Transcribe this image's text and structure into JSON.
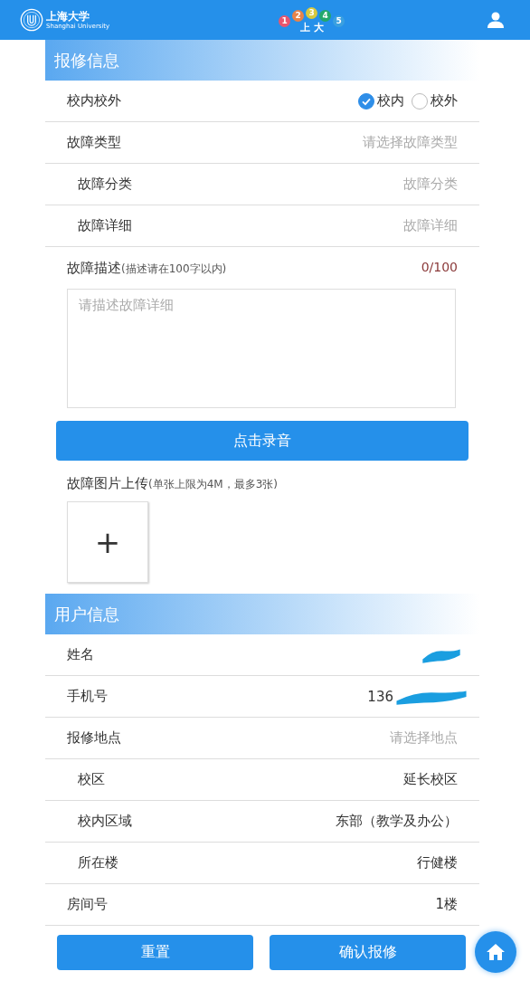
{
  "header": {
    "logo": {
      "name": "上海大学",
      "subtitle": "Shanghai University"
    },
    "badge": {
      "digits": [
        "1",
        "2",
        "3",
        "4",
        "5"
      ],
      "caption": "上 大"
    }
  },
  "repair": {
    "title": "报修信息",
    "rows": [
      {
        "kind": "radio",
        "label": "校内校外",
        "options": [
          {
            "label": "校内",
            "selected": true
          },
          {
            "label": "校外",
            "selected": false
          }
        ]
      },
      {
        "kind": "select",
        "label": "故障类型",
        "placeholder": "请选择故障类型",
        "children": [
          {
            "kind": "select",
            "label": "故障分类",
            "placeholder": "故障分类"
          },
          {
            "kind": "select",
            "label": "故障详细",
            "placeholder": "故障详细"
          }
        ]
      }
    ],
    "description": {
      "label": "故障描述",
      "hint": "(描述请在100字以内)",
      "counter": "0/100",
      "placeholder": "请描述故障详细"
    },
    "record_button": "点击录音",
    "upload": {
      "label": "故障图片上传",
      "hint": "(单张上限为4M，最多3张)",
      "add": "+"
    }
  },
  "user": {
    "title": "用户信息",
    "rows": [
      {
        "kind": "text",
        "label": "姓名",
        "redacted": true
      },
      {
        "kind": "text",
        "label": "手机号",
        "value": "136",
        "redacted": true
      },
      {
        "kind": "select",
        "label": "报修地点",
        "placeholder": "请选择地点",
        "children": [
          {
            "kind": "text",
            "label": "校区",
            "value": "延长校区"
          },
          {
            "kind": "text",
            "label": "校内区域",
            "value": "东部（教学及办公）"
          },
          {
            "kind": "text",
            "label": "所在楼",
            "value": "行健楼"
          }
        ]
      },
      {
        "kind": "text",
        "label": "房间号",
        "value": "1楼"
      }
    ]
  },
  "buttons": [
    "重置",
    "确认报修"
  ]
}
